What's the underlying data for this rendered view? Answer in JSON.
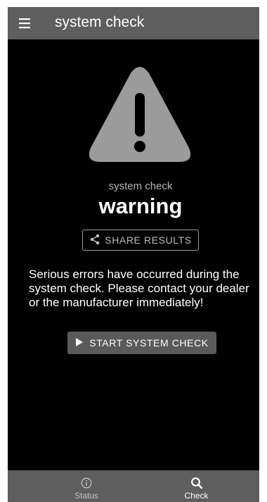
{
  "appbar": {
    "title": "system check",
    "menu_icon": "hamburger-menu-icon"
  },
  "status": {
    "icon": "warning-triangle-icon",
    "subtitle": "system check",
    "headline": "warning"
  },
  "share_button": {
    "label": "SHARE RESULTS",
    "icon": "share-icon"
  },
  "message": "Serious errors have occurred during the system check. Please contact your dealer or the manufacturer immediately!",
  "start_button": {
    "label": "START SYSTEM CHECK",
    "icon": "play-icon"
  },
  "bottom_nav": {
    "items": [
      {
        "label": "Status",
        "icon": "info-icon",
        "active": false
      },
      {
        "label": "Check",
        "icon": "search-icon",
        "active": true
      }
    ]
  },
  "colors": {
    "background": "#000000",
    "bar": "#5e5e5e",
    "icon_gray": "#9b9b9b",
    "button_gray": "#5a5a5a"
  }
}
